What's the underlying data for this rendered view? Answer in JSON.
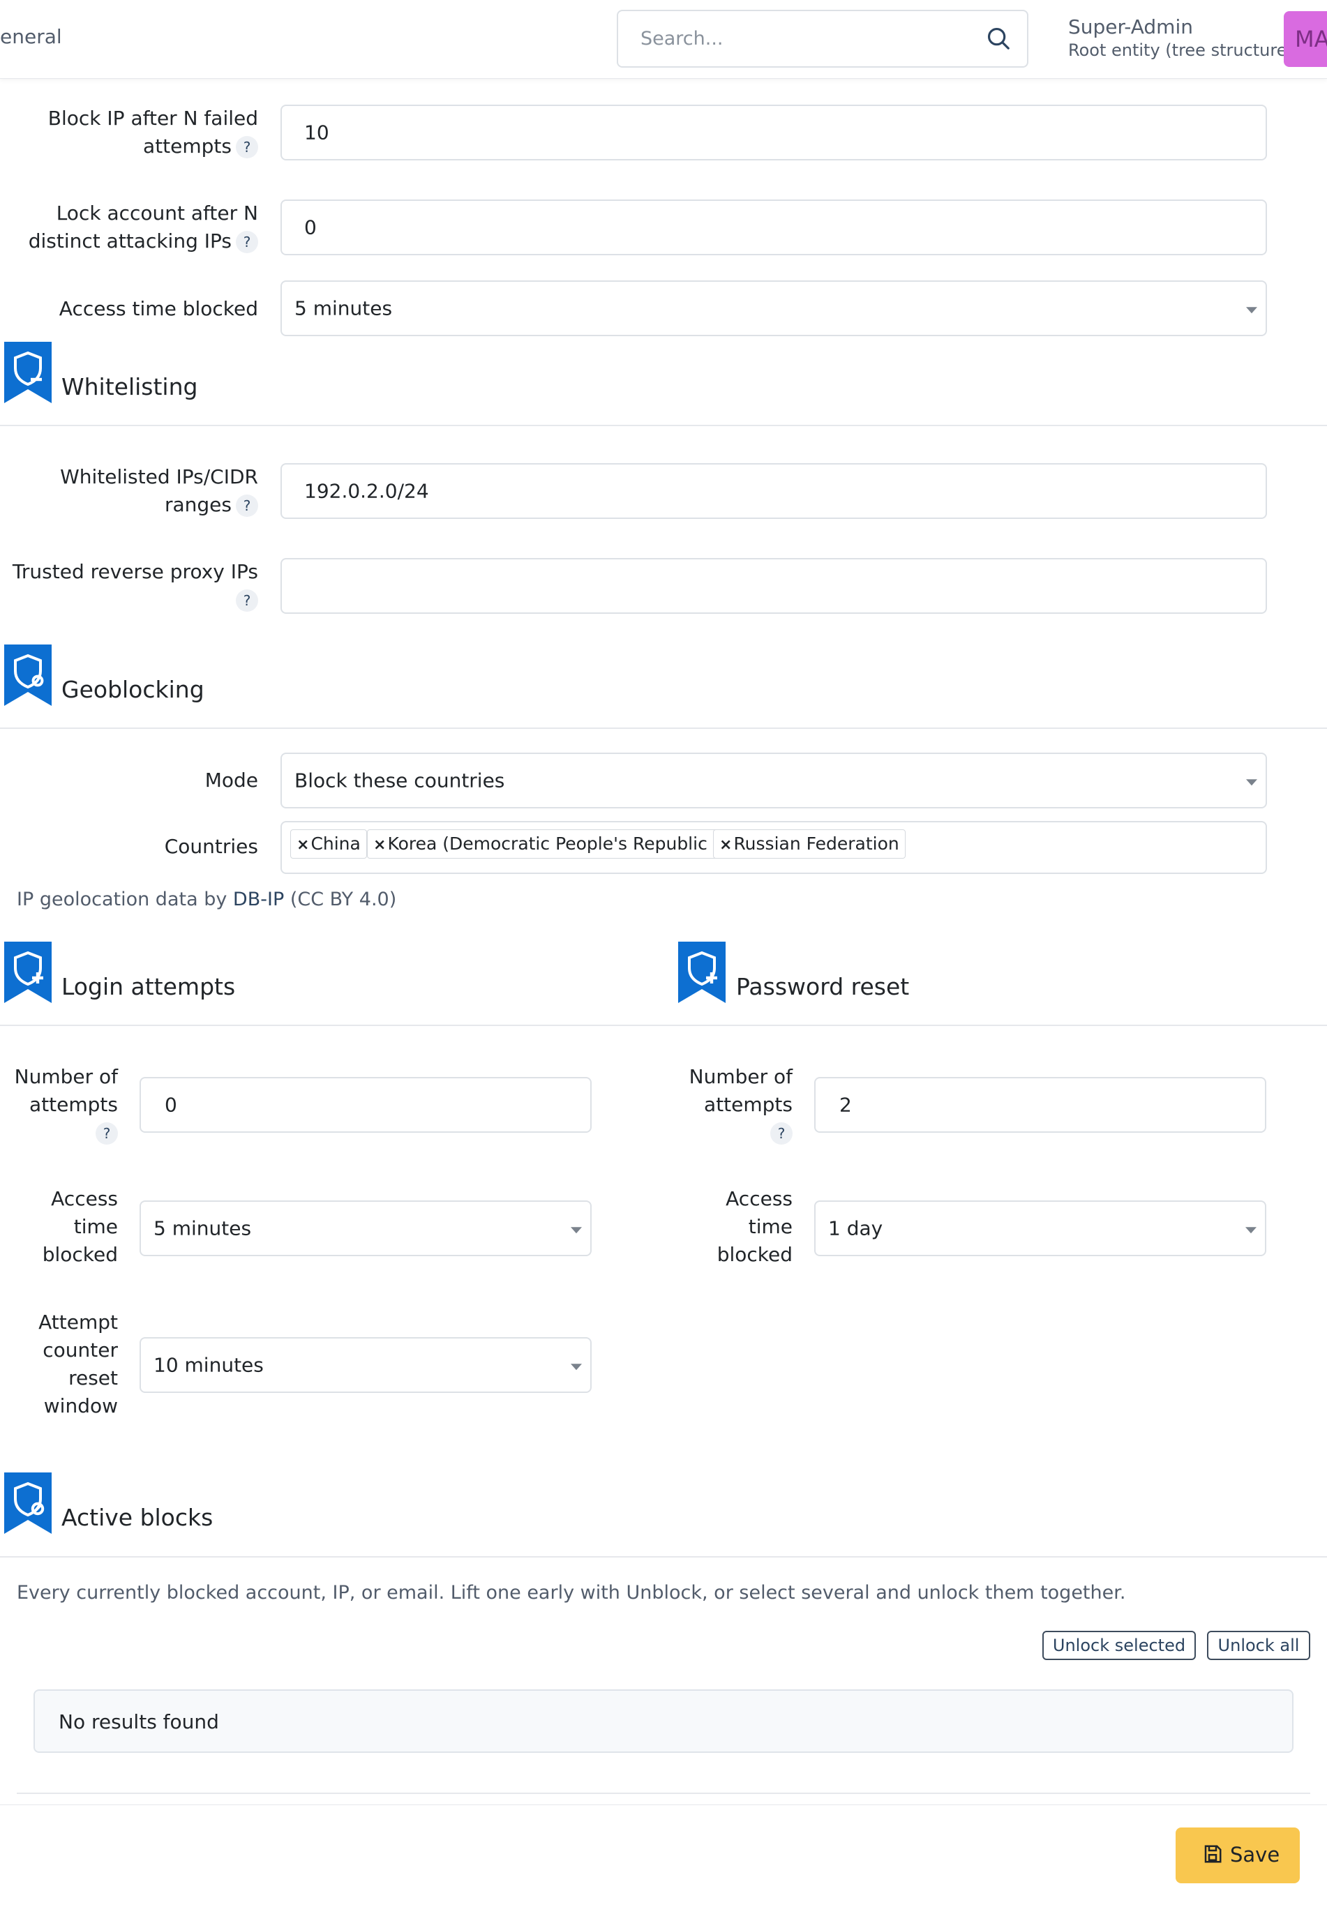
{
  "header": {
    "breadcrumb": "eneral",
    "search_placeholder": "Search...",
    "user_name": "Super-Admin",
    "user_entity": "Root entity (tree structure)",
    "avatar_initials": "MA",
    "avatar_color": "#d96be0"
  },
  "brute_force": {
    "block_ip_label_1": "Block IP after N failed",
    "block_ip_label_2": "attempts",
    "block_ip_value": "10",
    "lock_account_label_1": "Lock account after N",
    "lock_account_label_2": "distinct attacking IPs",
    "lock_account_value": "0",
    "access_time_label": "Access time blocked",
    "access_time_value": "5 minutes"
  },
  "whitelisting": {
    "title": "Whitelisting",
    "ips_label_1": "Whitelisted IPs/CIDR",
    "ips_label_2": "ranges",
    "ips_value": "192.0.2.0/24",
    "proxy_label": "Trusted reverse proxy IPs",
    "proxy_value": ""
  },
  "geoblocking": {
    "title": "Geoblocking",
    "mode_label": "Mode",
    "mode_value": "Block these countries",
    "countries_label": "Countries",
    "countries": [
      "China",
      "Korea (Democratic People's Republic of)",
      "Russian Federation"
    ],
    "note_prefix": "IP geolocation data by ",
    "note_link": "DB-IP",
    "note_suffix": " (CC BY 4.0)"
  },
  "login_attempts": {
    "title": "Login attempts",
    "attempts_label_1": "Number of",
    "attempts_label_2": "attempts",
    "attempts_value": "0",
    "access_label_1": "Access",
    "access_label_2": "time",
    "access_label_3": "blocked",
    "access_value": "5 minutes",
    "reset_label_1": "Attempt",
    "reset_label_2": "counter",
    "reset_label_3": "reset",
    "reset_label_4": "window",
    "reset_value": "10 minutes"
  },
  "password_reset": {
    "title": "Password reset",
    "attempts_label_1": "Number of",
    "attempts_label_2": "attempts",
    "attempts_value": "2",
    "access_label_1": "Access",
    "access_label_2": "time",
    "access_label_3": "blocked",
    "access_value": "1 day"
  },
  "active_blocks": {
    "title": "Active blocks",
    "description": "Every currently blocked account, IP, or email. Lift one early with Unblock, or select several and unlock them together.",
    "unlock_selected": "Unlock selected",
    "unlock_all": "Unlock all",
    "empty_text": "No results found"
  },
  "help_glyph": "?",
  "tag_remove_glyph": "×",
  "save_label": "Save",
  "colors": {
    "accent": "#0d6fd1",
    "save": "#f9c74f",
    "link": "#2c4460"
  }
}
